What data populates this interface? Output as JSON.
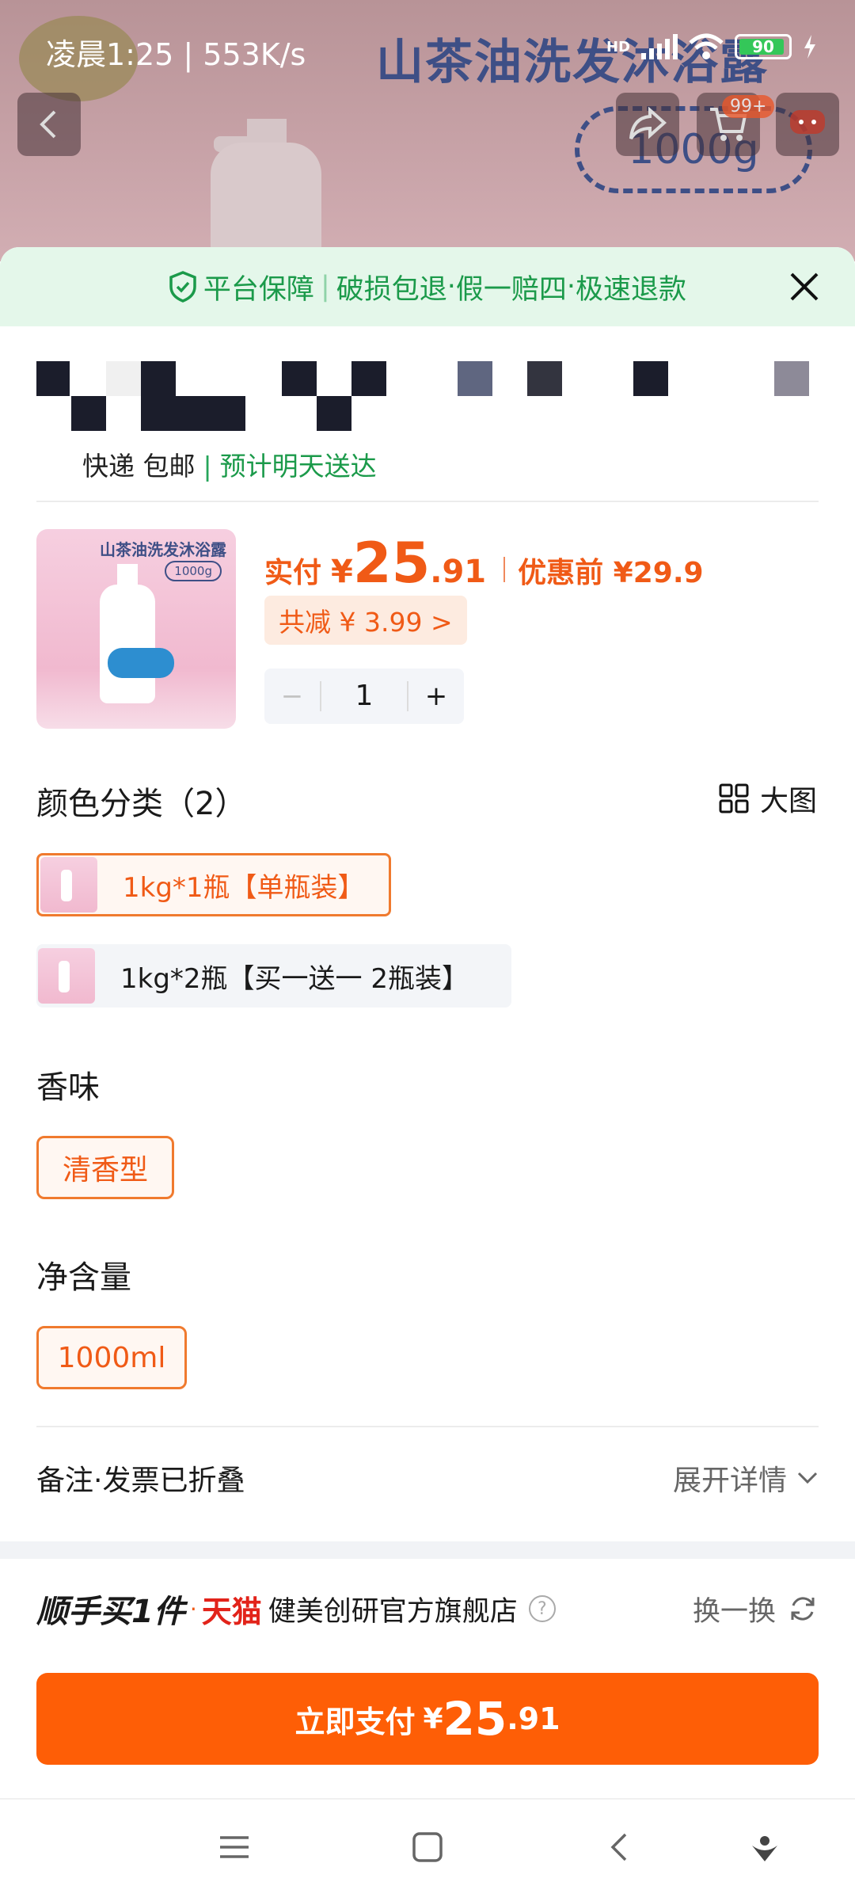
{
  "status_bar": {
    "time_speed": "凌晨1:25 | 553K/s",
    "network_label": "HD",
    "battery": "90"
  },
  "background": {
    "product_title": "山茶油洗发沐浴露",
    "size_tag": "1000g",
    "cart_badge": "99+"
  },
  "guarantee": {
    "platform": "平台保障",
    "item1": "破损包退",
    "item2": "假一赔四",
    "item3": "极速退款"
  },
  "delivery": {
    "method": "快递 包邮",
    "eta": "预计明天送达"
  },
  "product": {
    "thumb_title": "山茶油洗发沐浴露",
    "thumb_size": "1000g",
    "paid_label": "实付",
    "yen": "¥",
    "price_int": "25",
    "price_dec": ".91",
    "original": "优惠前 ¥29.9",
    "discount": "共减 ¥ 3.99 >",
    "quantity": "1",
    "minus": "−",
    "plus": "+"
  },
  "color_section": {
    "title": "颜色分类（2）",
    "big_image": "大图",
    "options": [
      {
        "label": "1kg*1瓶【单瓶装】",
        "selected": true
      },
      {
        "label": "1kg*2瓶【买一送一 2瓶装】",
        "selected": false
      }
    ]
  },
  "scent_section": {
    "title": "香味",
    "option": "清香型"
  },
  "volume_section": {
    "title": "净含量",
    "option": "1000ml"
  },
  "notes": {
    "label": "备注·发票已折叠",
    "expand": "展开详情"
  },
  "shop": {
    "promo": "顺手买1件",
    "dot": "·",
    "platform": "天猫",
    "name": "健美创研官方旗舰店",
    "help": "?",
    "swap": "换一换"
  },
  "pay_button": {
    "label": "立即支付",
    "yen": "¥",
    "int": "25",
    "dec": ".91"
  },
  "colors": {
    "accent": "#fe5e06",
    "guarantee_green": "#1b9a4a",
    "tmall_red": "#e2231a"
  }
}
